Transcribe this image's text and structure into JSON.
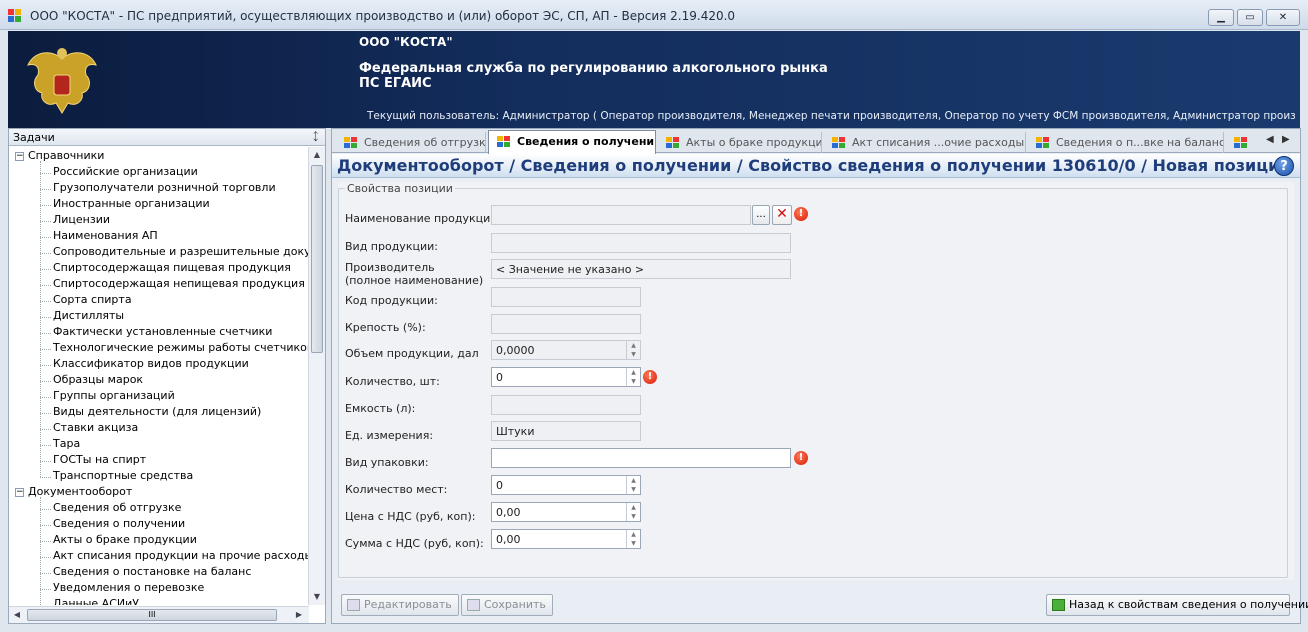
{
  "window": {
    "title": "ООО \"КОСТА\" - ПС предприятий, осуществляющих производство и (или) оборот ЭС, СП, АП - Версия 2.19.420.0",
    "minimize": "▁",
    "maximize": "▭",
    "close": "✕"
  },
  "banner": {
    "company": "ООО \"КОСТА\"",
    "agency_line1": "Федеральная служба по регулированию алкогольного рынка",
    "agency_line2": "ПС ЕГАИС",
    "current_user": "Текущий пользователь: Администратор ( Оператор производителя, Менеджер печати производителя, Оператор по учету ФСМ производителя, Администратор производителя, Опе..."
  },
  "tasks_panel": {
    "title": "Задачи",
    "pin": "ᛨ",
    "groups": [
      {
        "label": "Справочники",
        "expander": "−",
        "items": [
          "Российские организации",
          "Грузополучатели розничной торговли",
          "Иностранные организации",
          "Лицензии",
          "Наименования АП",
          "Сопроводительные и разрешительные документы",
          "Спиртосодержащая пищевая продукция",
          "Спиртосодержащая непищевая продукция",
          "Сорта спирта",
          "Дистилляты",
          "Фактически установленные счетчики",
          "Технологические режимы работы счетчиков",
          "Классификатор видов продукции",
          "Образцы марок",
          "Группы организаций",
          "Виды деятельности (для лицензий)",
          "Ставки акциза",
          "Тара",
          "ГОСТы на спирт",
          "Транспортные средства"
        ]
      },
      {
        "label": "Документооборот",
        "expander": "−",
        "items": [
          "Сведения об отгрузке",
          "Сведения о получении",
          "Акты о браке продукции",
          "Акт списания продукции на прочие расходы",
          "Сведения о постановке на баланс",
          "Уведомления о перевозке",
          "Данные АСИиУ"
        ]
      }
    ],
    "scroll_up": "▲",
    "scroll_down": "▼",
    "scroll_left": "◀",
    "scroll_right": "▶",
    "hthumb_grip": "III"
  },
  "tabs": [
    {
      "label": "Сведения об отгрузке",
      "active": false
    },
    {
      "label": "Сведения о получении",
      "active": true
    },
    {
      "label": "Акты о браке продукции",
      "active": false
    },
    {
      "label": "Акт списания ...очие расходы",
      "active": false
    },
    {
      "label": "Сведения о п...вке на баланс",
      "active": false
    }
  ],
  "tab_nav": {
    "prev": "◀",
    "next": "▶"
  },
  "breadcrumb": "Документооборот  / Сведения о получении / Свойство сведения о получении 130610/0 / Новая позиция",
  "help": "?",
  "form": {
    "group_title": "Свойства позиции",
    "browse": "...",
    "clear": "✕",
    "error_mark": "!",
    "spin_up": "▲",
    "spin_down": "▼",
    "fields": {
      "product_name": {
        "label": "Наименование продукции:",
        "value": ""
      },
      "product_type": {
        "label": "Вид продукции:",
        "value": ""
      },
      "producer": {
        "label": "Производитель\n(полное наименование)",
        "value": "< Значение не указано >"
      },
      "product_code": {
        "label": "Код продукции:",
        "value": ""
      },
      "strength": {
        "label": "Крепость (%):",
        "value": ""
      },
      "volume": {
        "label": "Объем продукции, дал",
        "value": "0,0000"
      },
      "quantity": {
        "label": "Количество, шт:",
        "value": "0"
      },
      "capacity": {
        "label": "Емкость (л):",
        "value": ""
      },
      "unit": {
        "label": "Ед. измерения:",
        "value": "Штуки"
      },
      "package": {
        "label": "Вид упаковки:",
        "value": ""
      },
      "places": {
        "label": "Количество мест:",
        "value": "0"
      },
      "price": {
        "label": "Цена с НДС  (руб, коп):",
        "value": "0,00"
      },
      "sum": {
        "label": "Сумма с НДС  (руб, коп):",
        "value": "0,00"
      }
    }
  },
  "buttons": {
    "edit": "Редактировать",
    "save": "Сохранить",
    "back": "Назад к свойствам сведения о получении"
  }
}
